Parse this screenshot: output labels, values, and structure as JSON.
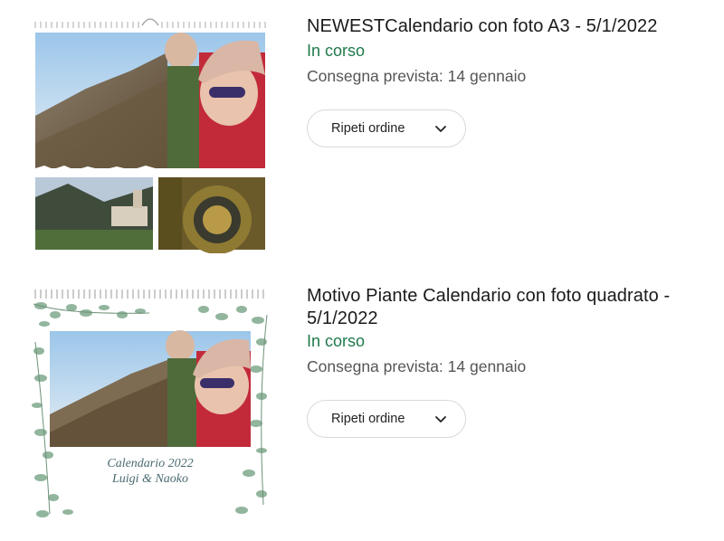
{
  "orders": [
    {
      "title": "NEWESTCalendario con foto A3 - 5/1/2022",
      "status": "In corso",
      "delivery": "Consegna prevista: 14 gennaio",
      "reorder_label": "Ripeti ordine",
      "reorder_icon": "chevron-down-icon"
    },
    {
      "title": "Motivo Piante Calendario con foto quadrato - 5/1/2022",
      "status": "In corso",
      "delivery": "Consegna prevista: 14 gennaio",
      "reorder_label": "Ripeti ordine",
      "reorder_icon": "chevron-down-icon",
      "calendar_caption_line1": "Calendario 2022",
      "calendar_caption_line2": "Luigi & Naoko"
    }
  ],
  "colors": {
    "status_green": "#1e7a4a",
    "button_border": "#d9d9d9",
    "text_primary": "#1a1a1a",
    "text_secondary": "#555555"
  }
}
